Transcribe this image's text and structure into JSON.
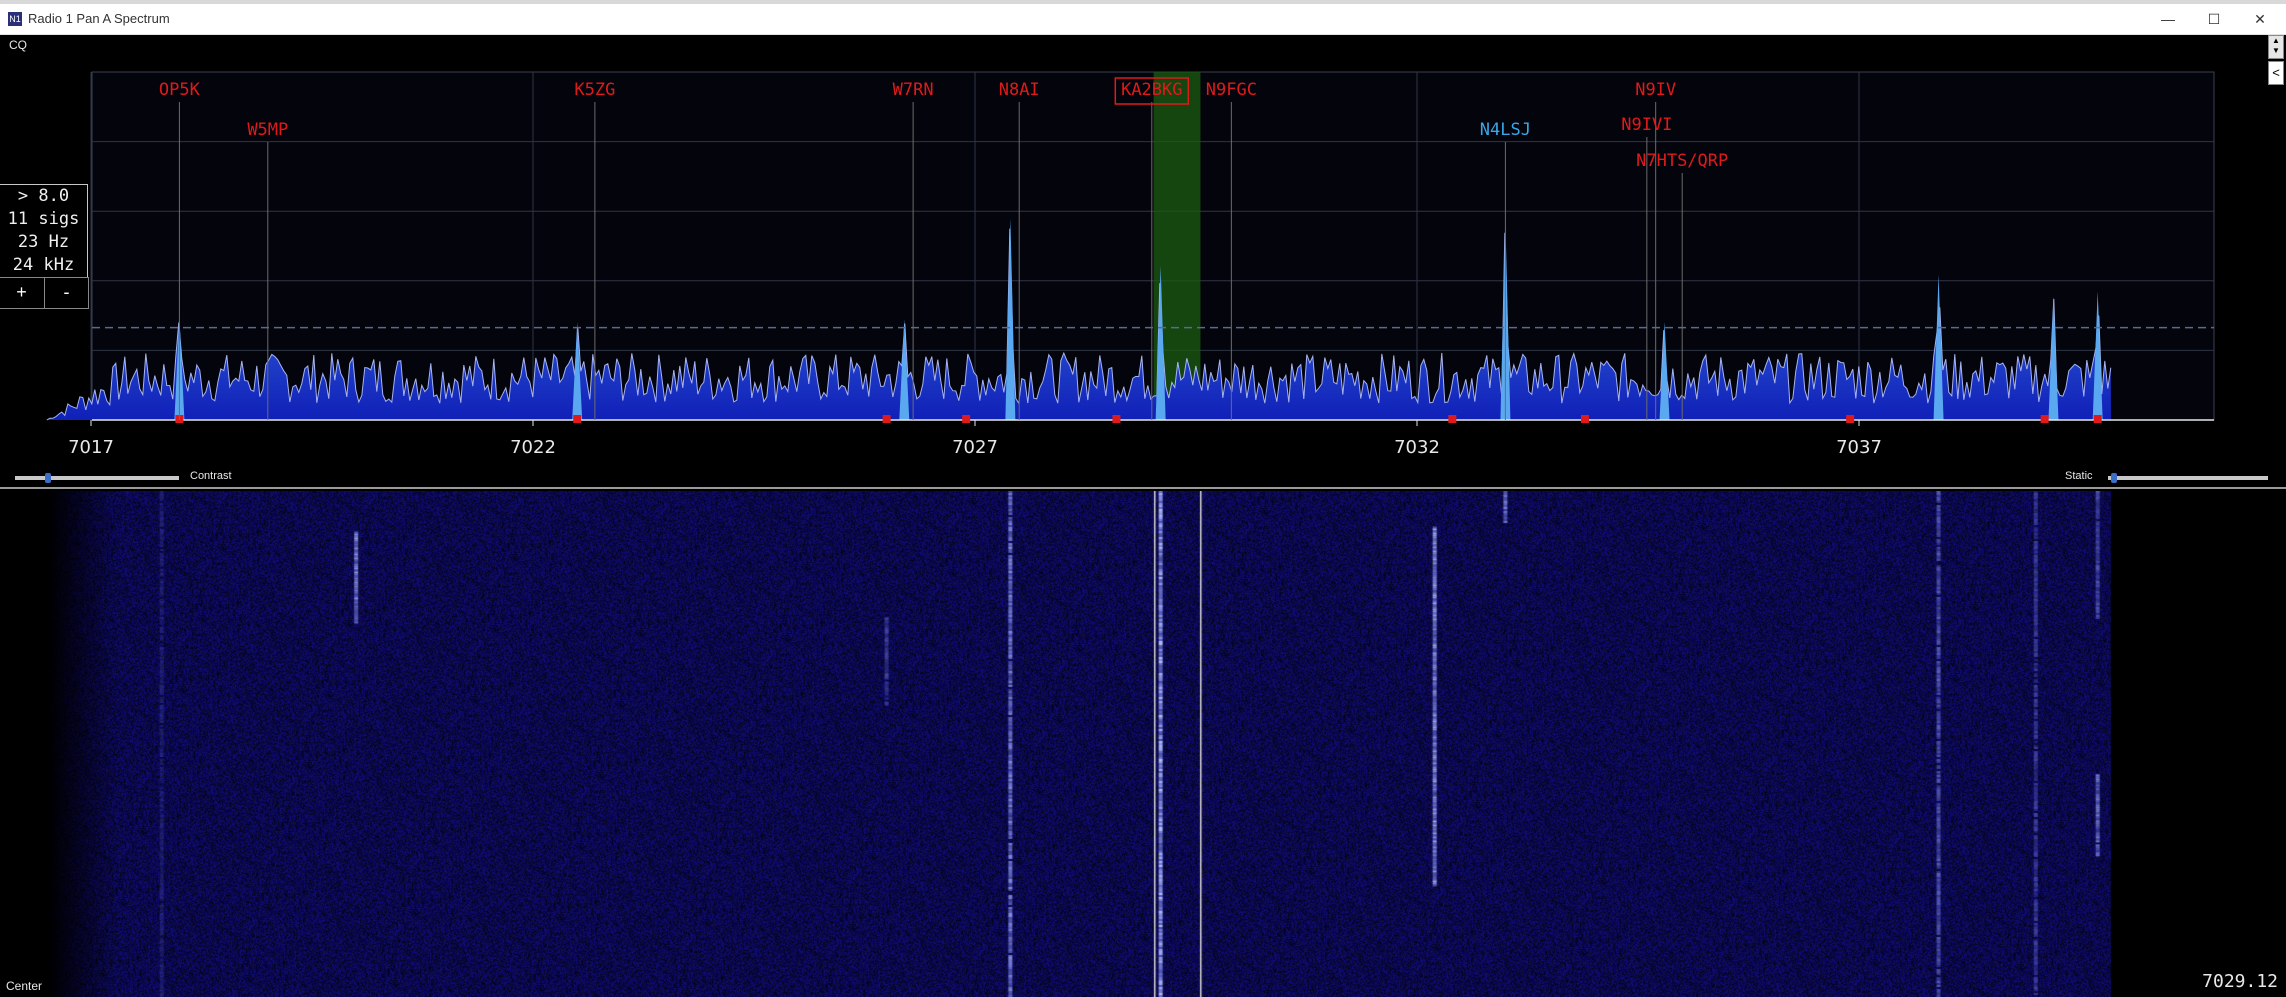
{
  "window": {
    "title": "Radio 1 Pan A Spectrum",
    "icon": "n1mm-app-icon"
  },
  "controls": {
    "mode_label": "CQ",
    "contrast_label": "Contrast",
    "static_label": "Static",
    "contrast_level": 0.2,
    "static_level": 0.02,
    "plus_label": "+",
    "minus_label": "-",
    "center_label": "Center",
    "cursor_frequency": "7029.12"
  },
  "info_box": {
    "threshold": "> 8.0",
    "signal_count": "11 sigs",
    "resolution": "23 Hz",
    "span": "24 kHz"
  },
  "colors": {
    "spot_red": "#e01a1a",
    "spot_blue": "#38a6e8",
    "spectrum_fill": "#1020b8",
    "grid": "#2e3446",
    "threshold_line": "#5a6b90",
    "tuning_band": "#1c5c12",
    "background": "#000000"
  },
  "chart_data": {
    "type": "area",
    "xlabel": "",
    "ylabel": "",
    "xlim": [
      7016.0,
      7040.0
    ],
    "x_ticks": [
      7017,
      7022,
      7027,
      7032,
      7037
    ],
    "tick_labels": [
      "7017",
      "7022",
      "7027",
      "7032",
      "7037"
    ],
    "threshold_level": 0.33,
    "tuned_frequency": 7029.12,
    "tuning_band": [
      7029.02,
      7029.55
    ],
    "grid": true,
    "peaks": [
      {
        "f": 7018.0,
        "level": 0.37
      },
      {
        "f": 7022.5,
        "level": 0.35
      },
      {
        "f": 7026.2,
        "level": 0.36
      },
      {
        "f": 7027.4,
        "level": 0.72
      },
      {
        "f": 7029.1,
        "level": 0.55
      },
      {
        "f": 7033.0,
        "level": 0.71
      },
      {
        "f": 7034.8,
        "level": 0.35
      },
      {
        "f": 7037.9,
        "level": 0.52
      },
      {
        "f": 7039.2,
        "level": 0.44
      },
      {
        "f": 7039.7,
        "level": 0.46
      }
    ],
    "markers": [
      7018.0,
      7022.5,
      7026.0,
      7026.9,
      7028.6,
      7032.4,
      7033.9,
      7036.9,
      7039.1,
      7039.7
    ],
    "spots": [
      {
        "call": "OP5K",
        "f": 7018.0,
        "row": 0,
        "color": "red"
      },
      {
        "call": "W5MP",
        "f": 7019.0,
        "row": 1,
        "color": "red"
      },
      {
        "call": "K5ZG",
        "f": 7022.7,
        "row": 0,
        "color": "red"
      },
      {
        "call": "W7RN",
        "f": 7026.3,
        "row": 0,
        "color": "red"
      },
      {
        "call": "N8AI",
        "f": 7027.5,
        "row": 0,
        "color": "red"
      },
      {
        "call": "KA2BKG",
        "f": 7029.0,
        "row": 0,
        "color": "red",
        "selected": true
      },
      {
        "call": "N9FGC",
        "f": 7029.9,
        "row": 0,
        "color": "red"
      },
      {
        "call": "N9IV",
        "f": 7034.7,
        "row": 0,
        "color": "red"
      },
      {
        "call": "N4LSJ",
        "f": 7033.0,
        "row": 1,
        "color": "blue"
      },
      {
        "call": "N9IVI",
        "f": 7034.6,
        "row": 2,
        "color": "red"
      },
      {
        "call": "N7HTS/QRP",
        "f": 7035.0,
        "row": 3,
        "color": "red"
      }
    ],
    "waterfall_traces": [
      {
        "f": 7017.8,
        "from": 0.0,
        "to": 1.0,
        "strength": 0.25
      },
      {
        "f": 7020.0,
        "from": 0.08,
        "to": 0.26,
        "strength": 0.9
      },
      {
        "f": 7026.0,
        "from": 0.25,
        "to": 0.42,
        "strength": 0.5
      },
      {
        "f": 7027.4,
        "from": 0.0,
        "to": 1.0,
        "strength": 0.8
      },
      {
        "f": 7029.1,
        "from": 0.0,
        "to": 1.0,
        "strength": 1.0
      },
      {
        "f": 7032.2,
        "from": 0.07,
        "to": 0.78,
        "strength": 0.95
      },
      {
        "f": 7033.0,
        "from": 0.0,
        "to": 0.06,
        "strength": 0.8
      },
      {
        "f": 7037.9,
        "from": 0.0,
        "to": 1.0,
        "strength": 0.6
      },
      {
        "f": 7039.0,
        "from": 0.0,
        "to": 1.0,
        "strength": 0.45
      },
      {
        "f": 7039.7,
        "from": 0.0,
        "to": 0.25,
        "strength": 0.55
      },
      {
        "f": 7039.7,
        "from": 0.56,
        "to": 0.72,
        "strength": 0.75
      }
    ]
  }
}
